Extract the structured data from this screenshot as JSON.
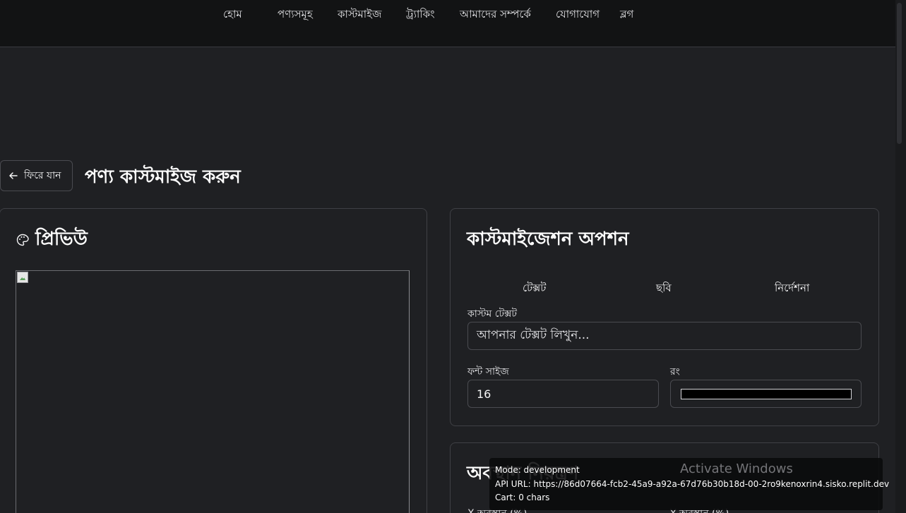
{
  "nav": {
    "items": [
      "হোম",
      "পণ্যসমূহ",
      "কাস্টমাইজ",
      "ট্র্যাকিং",
      "আমাদের সম্পর্কে",
      "যোগাযোগ",
      "ব্লগ"
    ]
  },
  "header": {
    "back_label": "ফিরে যান",
    "page_title": "পণ্য কাস্টমাইজ করুন"
  },
  "preview": {
    "title": "প্রিভিউ",
    "icon": "palette-icon"
  },
  "options": {
    "title": "কাস্টমাইজেশন অপশন",
    "tabs": [
      "টেক্সট",
      "ছবি",
      "নির্দেশনা"
    ],
    "custom_text_label": "কাস্টম টেক্সট",
    "custom_text_placeholder": "আপনার টেক্সট লিখুন...",
    "font_size_label": "ফন্ট সাইজ",
    "font_size_value": "16",
    "color_label": "রং",
    "color_value": "#000000"
  },
  "position": {
    "title": "অবস্থান নিয়ন্ত্রণ",
    "x_label": "X অবস্থান (%)",
    "y_label": "Y অবস্থান (%)"
  },
  "debug": {
    "mode": "Mode: development",
    "api_url": "API URL: https://86d07664-fcb2-45a9-a92a-67d76b30b18d-00-2ro9kenoxrin4.sisko.replit.dev",
    "cart": "Cart: 0 chars"
  },
  "watermark": {
    "text": "Activate Windows"
  }
}
